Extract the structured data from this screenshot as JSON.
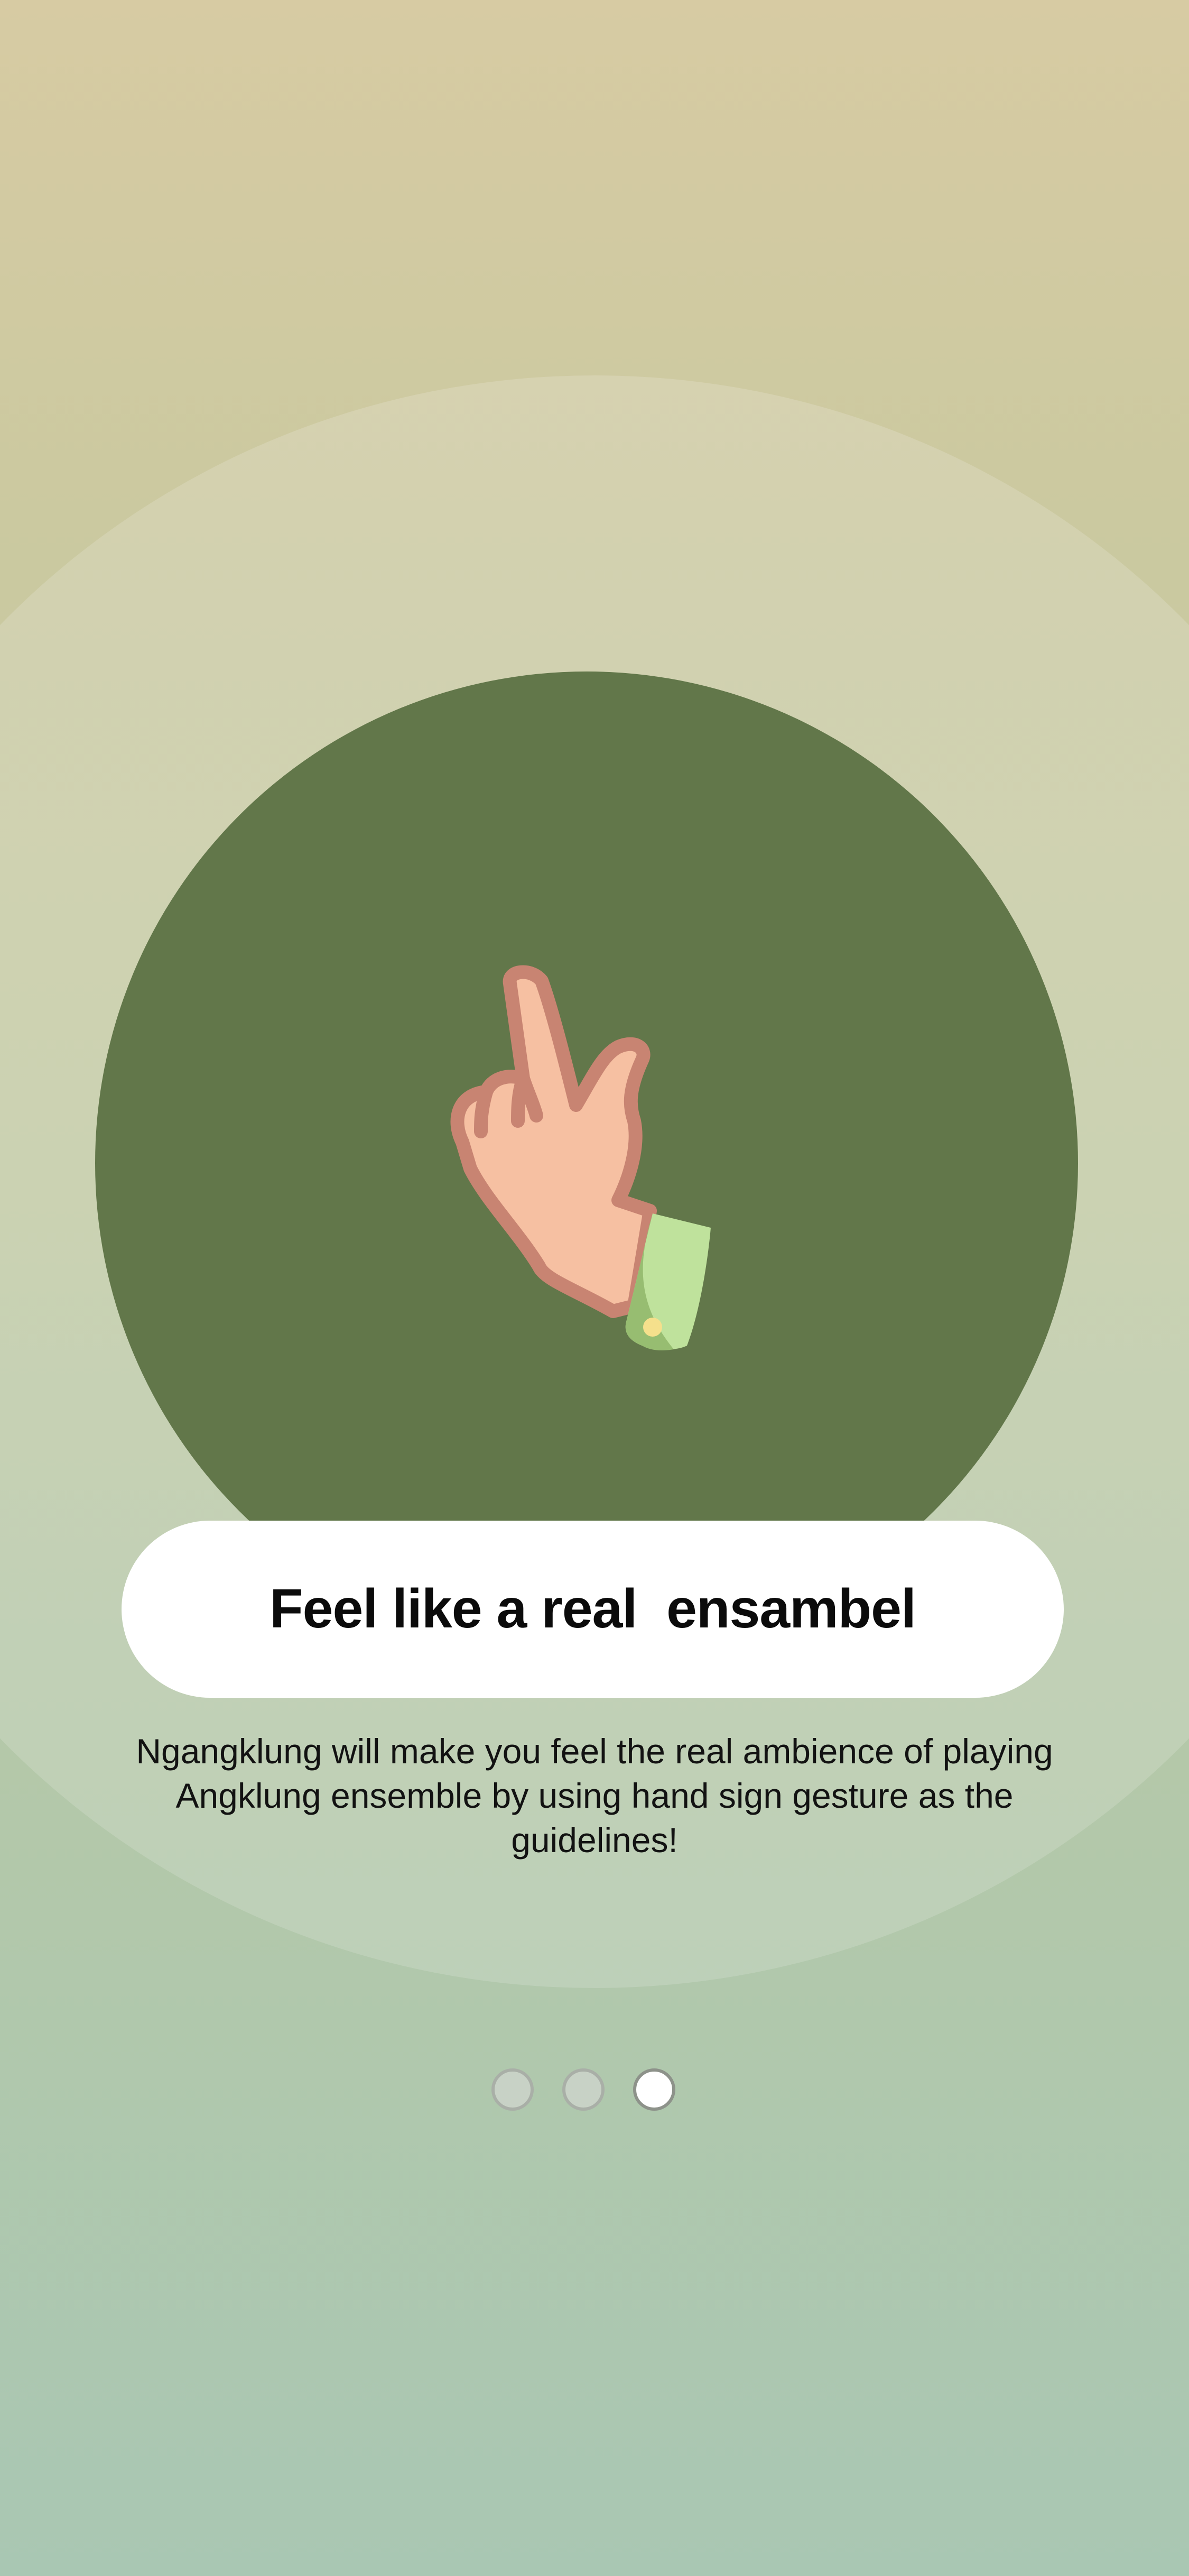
{
  "onboarding": {
    "title": "Feel like a real  ensambel",
    "description": "Ngangklung will make you feel the real ambience of playing Angklung ensemble by using hand sign gesture as the guidelines!",
    "illustration_icon": "hand-sign-gesture-icon",
    "page_indicator": {
      "total": 3,
      "active_index": 2
    }
  },
  "colors": {
    "hero_circle": "#62774a",
    "skin": "#f6c0a2",
    "skin_outline": "#c88472",
    "sleeve": "#bfe29c",
    "sleeve_shadow": "#97bd71",
    "button_dot": "#f5e08c"
  }
}
